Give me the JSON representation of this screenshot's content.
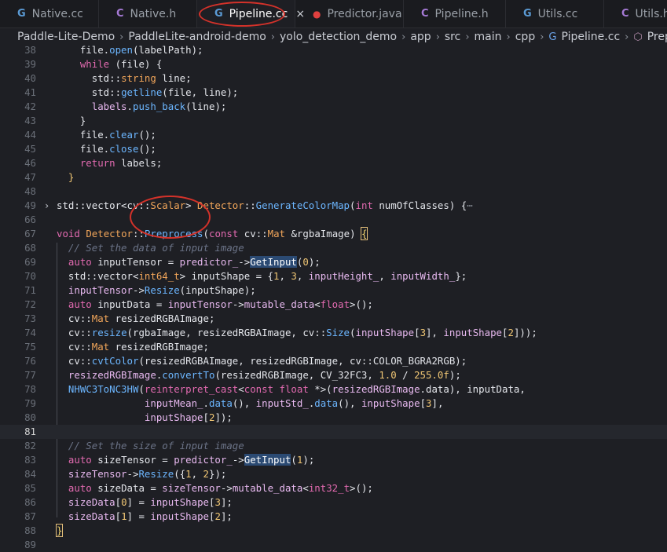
{
  "tabs": [
    {
      "label": "Native.cc",
      "icon": "c-file-icon",
      "glyph": "G",
      "active": false
    },
    {
      "label": "Native.h",
      "icon": "c-header-icon",
      "glyph": "C",
      "active": false
    },
    {
      "label": "Pipeline.cc",
      "icon": "c-file-icon",
      "glyph": "G",
      "active": true
    },
    {
      "label": "Predictor.java",
      "icon": "java-file-icon",
      "glyph": "●",
      "active": false
    },
    {
      "label": "Pipeline.h",
      "icon": "c-header-icon",
      "glyph": "C",
      "active": false
    },
    {
      "label": "Utils.cc",
      "icon": "c-file-icon",
      "glyph": "G",
      "active": false
    },
    {
      "label": "Utils.h",
      "icon": "c-header-icon",
      "glyph": "C",
      "active": false
    }
  ],
  "tab_close_glyph": "×",
  "breadcrumb": [
    "Paddle-Lite-Demo",
    "PaddleLite-android-demo",
    "yolo_detection_demo",
    "app",
    "src",
    "main",
    "cpp",
    "Pipeline.cc",
    "Preprocess(cons"
  ],
  "breadcrumb_sep": "›",
  "lines": [
    {
      "n": "38",
      "tokens": [
        [
          "pl",
          "    file."
        ],
        [
          "fn",
          "open"
        ],
        [
          "pl",
          "(labelPath);"
        ]
      ]
    },
    {
      "n": "39",
      "tokens": [
        [
          "kw",
          "    while"
        ],
        [
          "pl",
          " (file) {"
        ]
      ]
    },
    {
      "n": "40",
      "tokens": [
        [
          "pl",
          "      std::"
        ],
        [
          "ty",
          "string"
        ],
        [
          "pl",
          " line;"
        ]
      ]
    },
    {
      "n": "41",
      "tokens": [
        [
          "pl",
          "      std::"
        ],
        [
          "fn",
          "getline"
        ],
        [
          "pl",
          "(file, line);"
        ]
      ]
    },
    {
      "n": "42",
      "tokens": [
        [
          "vr",
          "      labels"
        ],
        [
          "pl",
          "."
        ],
        [
          "fn",
          "push_back"
        ],
        [
          "pl",
          "(line);"
        ]
      ]
    },
    {
      "n": "43",
      "tokens": [
        [
          "pl",
          "    }"
        ]
      ]
    },
    {
      "n": "44",
      "tokens": [
        [
          "pl",
          "    file."
        ],
        [
          "fn",
          "clear"
        ],
        [
          "pl",
          "();"
        ]
      ]
    },
    {
      "n": "45",
      "tokens": [
        [
          "pl",
          "    file."
        ],
        [
          "fn",
          "close"
        ],
        [
          "pl",
          "();"
        ]
      ]
    },
    {
      "n": "46",
      "tokens": [
        [
          "kw",
          "    return"
        ],
        [
          "pl",
          " labels;"
        ]
      ]
    },
    {
      "n": "47",
      "tokens": [
        [
          "nm",
          "  }"
        ]
      ]
    },
    {
      "n": "48",
      "tokens": []
    },
    {
      "n": "49",
      "fold": "›",
      "tokens": [
        [
          "pl",
          "std::vector<cv::"
        ],
        [
          "ty",
          "Scalar"
        ],
        [
          "pl",
          "> "
        ],
        [
          "ty",
          "Detector"
        ],
        [
          "pl",
          "::"
        ],
        [
          "fn",
          "GenerateColorMap"
        ],
        [
          "pl",
          "("
        ],
        [
          "kw",
          "int"
        ],
        [
          "pl",
          " numOfClasses) {"
        ],
        [
          "ellipsis",
          "⋯"
        ]
      ]
    },
    {
      "n": "66",
      "tokens": []
    },
    {
      "n": "67",
      "tokens": [
        [
          "kw",
          "void"
        ],
        [
          "pl",
          " "
        ],
        [
          "ty",
          "Detector"
        ],
        [
          "pl",
          "::"
        ],
        [
          "fn",
          "Preprocess"
        ],
        [
          "pl",
          "("
        ],
        [
          "kw",
          "const"
        ],
        [
          "pl",
          " cv::"
        ],
        [
          "ty",
          "Mat"
        ],
        [
          "pl",
          " &rgbaImage) "
        ],
        [
          "fbox",
          "{"
        ]
      ]
    },
    {
      "n": "68",
      "tokens": [
        [
          "cm",
          "  // Set the data of input image"
        ]
      ]
    },
    {
      "n": "69",
      "tokens": [
        [
          "kw",
          "  auto"
        ],
        [
          "pl",
          " inputTensor = "
        ],
        [
          "vr",
          "predictor_"
        ],
        [
          "pl",
          "->"
        ],
        [
          "hl",
          "GetInput"
        ],
        [
          "pl",
          "("
        ],
        [
          "nm",
          "0"
        ],
        [
          "pl",
          ");"
        ]
      ]
    },
    {
      "n": "70",
      "tokens": [
        [
          "pl",
          "  std::vector<"
        ],
        [
          "ty",
          "int64_t"
        ],
        [
          "pl",
          "> inputShape = {"
        ],
        [
          "nm",
          "1"
        ],
        [
          "pl",
          ", "
        ],
        [
          "nm",
          "3"
        ],
        [
          "pl",
          ", "
        ],
        [
          "vr",
          "inputHeight_"
        ],
        [
          "pl",
          ", "
        ],
        [
          "vr",
          "inputWidth_"
        ],
        [
          "pl",
          "};"
        ]
      ]
    },
    {
      "n": "71",
      "tokens": [
        [
          "vr",
          "  inputTensor"
        ],
        [
          "pl",
          "->"
        ],
        [
          "fn",
          "Resize"
        ],
        [
          "pl",
          "(inputShape);"
        ]
      ]
    },
    {
      "n": "72",
      "tokens": [
        [
          "kw",
          "  auto"
        ],
        [
          "pl",
          " inputData = "
        ],
        [
          "vr",
          "inputTensor"
        ],
        [
          "pl",
          "->"
        ],
        [
          "vr",
          "mutable_data"
        ],
        [
          "pl",
          "<"
        ],
        [
          "kw",
          "float"
        ],
        [
          "pl",
          ">();"
        ]
      ]
    },
    {
      "n": "73",
      "tokens": [
        [
          "pl",
          "  cv::"
        ],
        [
          "ty",
          "Mat"
        ],
        [
          "pl",
          " resizedRGBAImage;"
        ]
      ]
    },
    {
      "n": "74",
      "tokens": [
        [
          "pl",
          "  cv::"
        ],
        [
          "fn",
          "resize"
        ],
        [
          "pl",
          "(rgbaImage, resizedRGBAImage, cv::"
        ],
        [
          "fn",
          "Size"
        ],
        [
          "pl",
          "("
        ],
        [
          "vr",
          "inputShape"
        ],
        [
          "pl",
          "["
        ],
        [
          "nm",
          "3"
        ],
        [
          "pl",
          "], "
        ],
        [
          "vr",
          "inputShape"
        ],
        [
          "pl",
          "["
        ],
        [
          "nm",
          "2"
        ],
        [
          "pl",
          "]));"
        ]
      ]
    },
    {
      "n": "75",
      "tokens": [
        [
          "pl",
          "  cv::"
        ],
        [
          "ty",
          "Mat"
        ],
        [
          "pl",
          " resizedRGBImage;"
        ]
      ]
    },
    {
      "n": "76",
      "tokens": [
        [
          "pl",
          "  cv::"
        ],
        [
          "fn",
          "cvtColor"
        ],
        [
          "pl",
          "(resizedRGBAImage, resizedRGBImage, cv::COLOR_BGRA2RGB);"
        ]
      ]
    },
    {
      "n": "77",
      "tokens": [
        [
          "vr",
          "  resizedRGBImage"
        ],
        [
          "pl",
          "."
        ],
        [
          "fn",
          "convertTo"
        ],
        [
          "pl",
          "(resizedRGBImage, CV_32FC3, "
        ],
        [
          "nm",
          "1.0"
        ],
        [
          "pl",
          " / "
        ],
        [
          "nm",
          "255.0f"
        ],
        [
          "pl",
          ");"
        ]
      ]
    },
    {
      "n": "78",
      "tokens": [
        [
          "fn",
          "  NHWC3ToNC3HW"
        ],
        [
          "pl",
          "("
        ],
        [
          "kw",
          "reinterpret_cast"
        ],
        [
          "pl",
          "<"
        ],
        [
          "kw",
          "const float"
        ],
        [
          "pl",
          " *>("
        ],
        [
          "vr",
          "resizedRGBImage"
        ],
        [
          "pl",
          ".data), inputData,"
        ]
      ]
    },
    {
      "n": "79",
      "tokens": [
        [
          "pl",
          "               "
        ],
        [
          "vr",
          "inputMean_"
        ],
        [
          "pl",
          "."
        ],
        [
          "fn",
          "data"
        ],
        [
          "pl",
          "(), "
        ],
        [
          "vr",
          "inputStd_"
        ],
        [
          "pl",
          "."
        ],
        [
          "fn",
          "data"
        ],
        [
          "pl",
          "(), "
        ],
        [
          "vr",
          "inputShape"
        ],
        [
          "pl",
          "["
        ],
        [
          "nm",
          "3"
        ],
        [
          "pl",
          "],"
        ]
      ]
    },
    {
      "n": "80",
      "tokens": [
        [
          "pl",
          "               "
        ],
        [
          "vr",
          "inputShape"
        ],
        [
          "pl",
          "["
        ],
        [
          "nm",
          "2"
        ],
        [
          "pl",
          "]);"
        ]
      ]
    },
    {
      "n": "81",
      "current": true,
      "tokens": []
    },
    {
      "n": "82",
      "tokens": [
        [
          "cm",
          "  // Set the size of input image"
        ]
      ]
    },
    {
      "n": "83",
      "tokens": [
        [
          "kw",
          "  auto"
        ],
        [
          "pl",
          " sizeTensor = "
        ],
        [
          "vr",
          "predictor_"
        ],
        [
          "pl",
          "->"
        ],
        [
          "hl",
          "GetInput"
        ],
        [
          "pl",
          "("
        ],
        [
          "nm",
          "1"
        ],
        [
          "pl",
          ");"
        ]
      ]
    },
    {
      "n": "84",
      "tokens": [
        [
          "vr",
          "  sizeTensor"
        ],
        [
          "pl",
          "->"
        ],
        [
          "fn",
          "Resize"
        ],
        [
          "pl",
          "({"
        ],
        [
          "nm",
          "1"
        ],
        [
          "pl",
          ", "
        ],
        [
          "nm",
          "2"
        ],
        [
          "pl",
          "});"
        ]
      ]
    },
    {
      "n": "85",
      "tokens": [
        [
          "kw",
          "  auto"
        ],
        [
          "pl",
          " sizeData = "
        ],
        [
          "vr",
          "sizeTensor"
        ],
        [
          "pl",
          "->"
        ],
        [
          "vr",
          "mutable_data"
        ],
        [
          "pl",
          "<"
        ],
        [
          "kw",
          "int32_t"
        ],
        [
          "pl",
          ">();"
        ]
      ]
    },
    {
      "n": "86",
      "tokens": [
        [
          "vr",
          "  sizeData"
        ],
        [
          "pl",
          "["
        ],
        [
          "nm",
          "0"
        ],
        [
          "pl",
          "] = "
        ],
        [
          "vr",
          "inputShape"
        ],
        [
          "pl",
          "["
        ],
        [
          "nm",
          "3"
        ],
        [
          "pl",
          "];"
        ]
      ]
    },
    {
      "n": "87",
      "tokens": [
        [
          "vr",
          "  sizeData"
        ],
        [
          "pl",
          "["
        ],
        [
          "nm",
          "1"
        ],
        [
          "pl",
          "] = "
        ],
        [
          "vr",
          "inputShape"
        ],
        [
          "pl",
          "["
        ],
        [
          "nm",
          "2"
        ],
        [
          "pl",
          "];"
        ]
      ]
    },
    {
      "n": "88",
      "tokens": [
        [
          "fbox",
          "}"
        ]
      ]
    },
    {
      "n": "89",
      "tokens": []
    }
  ]
}
